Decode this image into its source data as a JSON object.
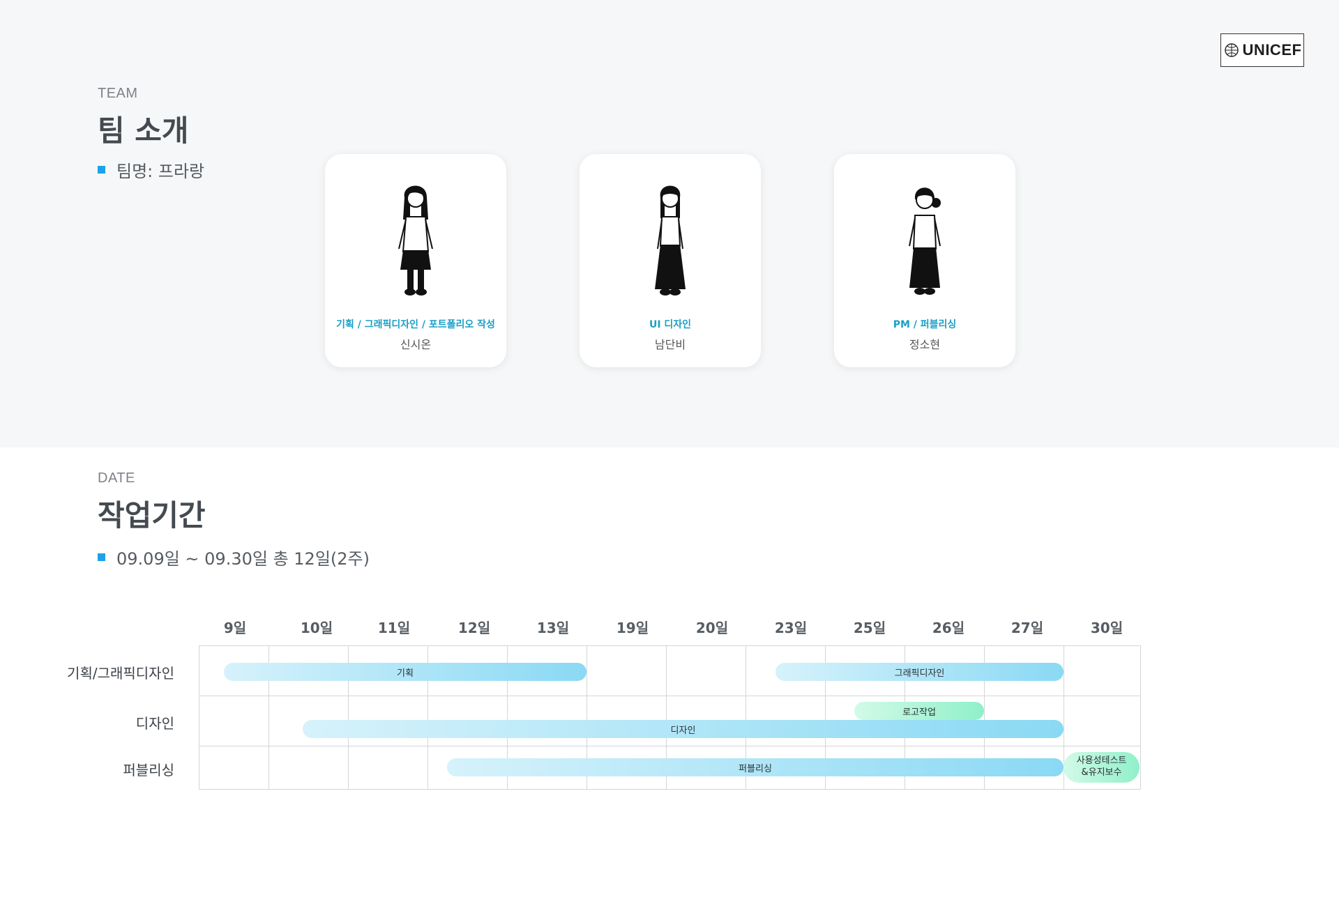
{
  "brand": {
    "logo_text": "UNICEF"
  },
  "team": {
    "eyebrow": "TEAM",
    "title": "팀 소개",
    "team_name": "팀명: 프라랑",
    "members": [
      {
        "role": "기획 / 그래픽디자인 / 포트폴리오 작성",
        "name": "신시온",
        "icon": "person-short-skirt-icon"
      },
      {
        "role": "UI 디자인",
        "name": "남단비",
        "icon": "person-long-skirt-icon"
      },
      {
        "role": "PM / 퍼블리싱",
        "name": "정소현",
        "icon": "person-bun-hair-icon"
      }
    ]
  },
  "schedule": {
    "eyebrow": "DATE",
    "title": "작업기간",
    "period": "09.09일 ~ 09.30일 총 12일(2주)",
    "days": [
      "9일",
      "10일",
      "11일",
      "12일",
      "13일",
      "19일",
      "20일",
      "23일",
      "25일",
      "26일",
      "27일",
      "30일"
    ],
    "rows": [
      "기획/그래픽디자인",
      "디자인",
      "퍼블리싱"
    ],
    "tasks": {
      "planning": "기획",
      "graphic_design": "그래픽디자인",
      "logo_work": "로고작업",
      "design": "디자인",
      "publishing": "퍼블리싱",
      "user_test_line1": "사용성테스트",
      "user_test_line2": "&유지보수"
    }
  },
  "colors": {
    "accent": "#1aa3e8",
    "role_text": "#1a9fc6",
    "bar_blue": "#8ad9f4",
    "bar_green": "#8ff0c9"
  }
}
